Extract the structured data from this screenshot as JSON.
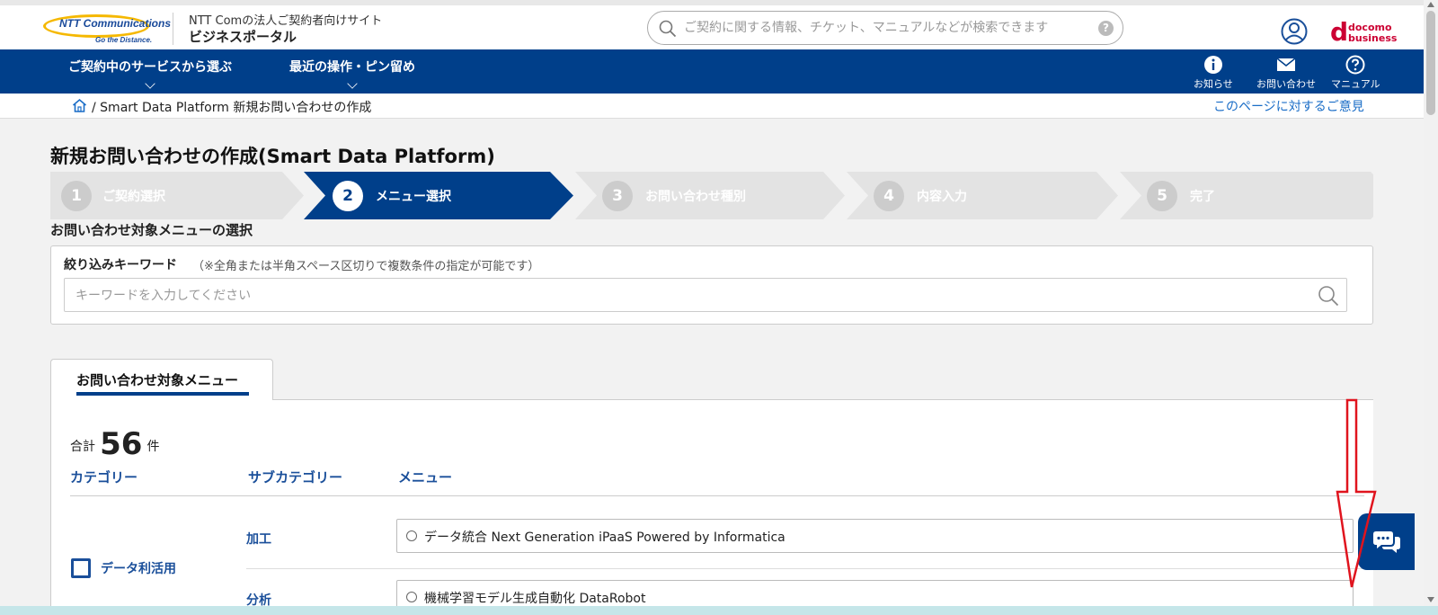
{
  "header": {
    "logo_text": "NTT Communications",
    "logo_tagline": "Go the Distance.",
    "site_subtitle": "NTT Comの法人ご契約者向けサイト",
    "site_title": "ビジネスポータル",
    "search_placeholder": "ご契約に関する情報、チケット、マニュアルなどが検索できます",
    "search_help": "?",
    "docomo_line1": "docomo",
    "docomo_line2": "business"
  },
  "nav": {
    "left": [
      {
        "label": "ご契約中のサービスから選ぶ"
      },
      {
        "label": "最近の操作・ピン留め"
      }
    ],
    "right": [
      {
        "label": "お知らせ",
        "icon": "info-icon"
      },
      {
        "label": "お問い合わせ",
        "icon": "mail-icon"
      },
      {
        "label": "マニュアル",
        "icon": "help-icon"
      }
    ]
  },
  "breadcrumb": {
    "separator": "/",
    "current": "Smart Data Platform 新規お問い合わせの作成",
    "feedback_link": "このページに対するご意見"
  },
  "page": {
    "title": "新規お問い合わせの作成(Smart Data Platform)",
    "section_title": "お問い合わせ対象メニューの選択"
  },
  "steps": [
    {
      "num": "1",
      "label": "ご契約選択",
      "active": false
    },
    {
      "num": "2",
      "label": "メニュー選択",
      "active": true
    },
    {
      "num": "3",
      "label": "お問い合わせ種別",
      "active": false
    },
    {
      "num": "4",
      "label": "内容入力",
      "active": false
    },
    {
      "num": "5",
      "label": "完了",
      "active": false
    }
  ],
  "filter": {
    "label": "絞り込みキーワード",
    "note": "（※全角または半角スペース区切りで複数条件の指定が可能です）",
    "placeholder": "キーワードを入力してください",
    "value": ""
  },
  "tab": {
    "label": "お問い合わせ対象メニュー"
  },
  "results": {
    "total_prefix": "合計",
    "total_count": "56",
    "total_suffix": "件",
    "columns": [
      "カテゴリー",
      "サブカテゴリー",
      "メニュー"
    ],
    "category": "データ利活用",
    "rows": [
      {
        "subcategory": "加工",
        "menu": "データ統合 Next Generation iPaaS Powered by Informatica"
      },
      {
        "subcategory": "分析",
        "menu": "機械学習モデル生成自動化 DataRobot"
      }
    ]
  },
  "colors": {
    "brand_blue": "#003f8a",
    "link_blue": "#1a6dc7",
    "step_inactive": "#e0e0e0",
    "annotation_red": "#e0141e"
  }
}
